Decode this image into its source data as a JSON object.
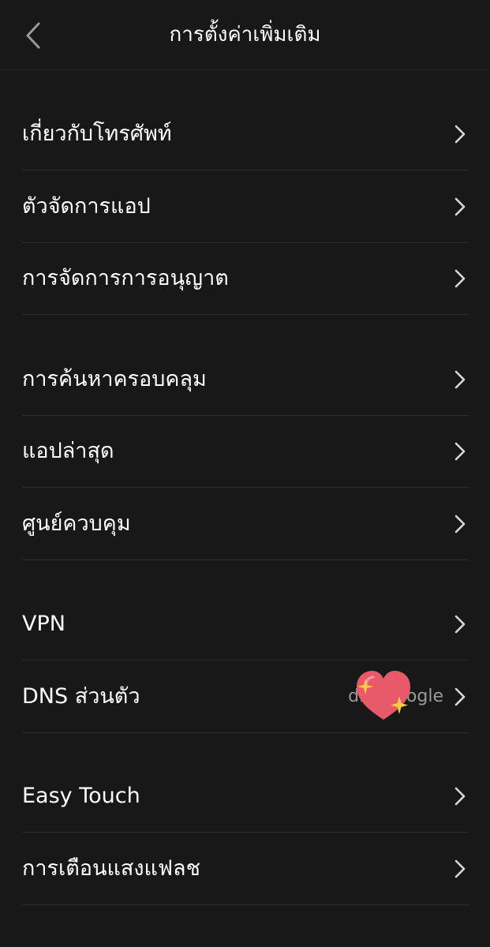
{
  "header": {
    "title": "การตั้งค่าเพิ่มเติม"
  },
  "icons": {
    "back": "chevron-left-icon",
    "row_arrow": "chevron-right-icon",
    "sticker": "sparkling-heart-icon"
  },
  "colors": {
    "background": "#181818",
    "text": "#ffffff",
    "secondary_text": "#9a9a9a",
    "divider": "#2c2c2c",
    "heart": "#e85a6a",
    "sparkle": "#f7c948"
  },
  "groups": [
    {
      "items": [
        {
          "label": "เกี่ยวกับโทรศัพท์"
        },
        {
          "label": "ตัวจัดการแอป"
        },
        {
          "label": "การจัดการการอนุญาต"
        }
      ]
    },
    {
      "items": [
        {
          "label": "การค้นหาครอบคลุม"
        },
        {
          "label": "แอปล่าสุด"
        },
        {
          "label": "ศูนย์ควบคุม"
        }
      ]
    },
    {
      "items": [
        {
          "label": "VPN"
        },
        {
          "label": "DNS ส่วนตัว",
          "value": "dns.google"
        }
      ]
    },
    {
      "items": [
        {
          "label": "Easy Touch"
        },
        {
          "label": "การเตือนแสงแฟลช"
        }
      ]
    }
  ]
}
